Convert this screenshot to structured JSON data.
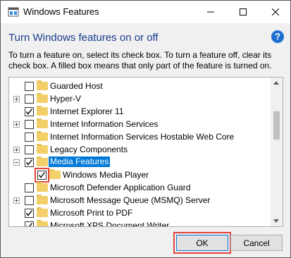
{
  "window": {
    "title": "Windows Features",
    "icon": "windows-features-icon"
  },
  "header": {
    "heading": "Turn Windows features on or off",
    "help_icon": "?"
  },
  "description": "To turn a feature on, select its check box. To turn a feature off, clear its check box. A filled box means that only part of the feature is turned on.",
  "features": [
    {
      "label": "Guarded Host",
      "checked": false,
      "expander": false
    },
    {
      "label": "Hyper-V",
      "checked": false,
      "expander": true
    },
    {
      "label": "Internet Explorer 11",
      "checked": true,
      "expander": false
    },
    {
      "label": "Internet Information Services",
      "checked": false,
      "expander": true
    },
    {
      "label": "Internet Information Services Hostable Web Core",
      "checked": false,
      "expander": false
    },
    {
      "label": "Legacy Components",
      "checked": false,
      "expander": true
    },
    {
      "label": "Media Features",
      "checked": true,
      "expander": true,
      "expanded": true,
      "selected": true
    },
    {
      "label": "Windows Media Player",
      "checked": true,
      "expander": false,
      "indent": 1
    },
    {
      "label": "Microsoft Defender Application Guard",
      "checked": false,
      "expander": false
    },
    {
      "label": "Microsoft Message Queue (MSMQ) Server",
      "checked": false,
      "expander": true
    },
    {
      "label": "Microsoft Print to PDF",
      "checked": true,
      "expander": false
    },
    {
      "label": "Microsoft XPS Document Writer",
      "checked": true,
      "expander": false
    }
  ],
  "buttons": {
    "ok": "OK",
    "cancel": "Cancel"
  },
  "colors": {
    "selection": "#0078d7",
    "heading": "#1a3d8f",
    "highlight": "#e0443b"
  }
}
